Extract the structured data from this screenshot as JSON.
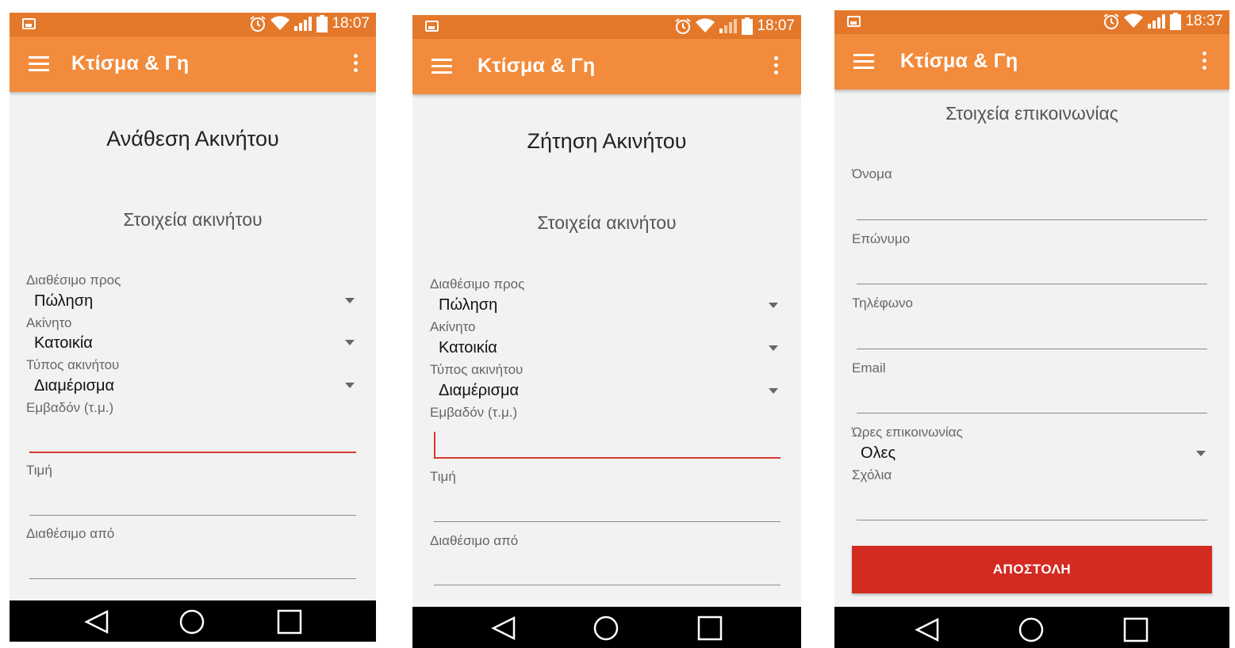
{
  "phones": [
    {
      "status": {
        "time": "18:07"
      },
      "appbar": {
        "title": "Κτίσμα & Γη"
      },
      "form": {
        "title": "Ανάθεση Ακινήτου",
        "section": "Στοιχεία ακινήτου",
        "available_for_label": "Διαθέσιμο προς",
        "available_for_value": "Πώληση",
        "property_label": "Ακίνητο",
        "property_value": "Κατοικία",
        "property_type_label": "Τύπος ακινήτου",
        "property_type_value": "Διαμέρισμα",
        "area_label": "Εμβαδόν (τ.μ.)",
        "price_label": "Τιμή",
        "available_from_label": "Διαθέσιμο από"
      }
    },
    {
      "status": {
        "time": "18:07"
      },
      "appbar": {
        "title": "Κτίσμα & Γη"
      },
      "form": {
        "title": "Ζήτηση Ακινήτου",
        "section": "Στοιχεία ακινήτου",
        "available_for_label": "Διαθέσιμο προς",
        "available_for_value": "Πώληση",
        "property_label": "Ακίνητο",
        "property_value": "Κατοικία",
        "property_type_label": "Τύπος ακινήτου",
        "property_type_value": "Διαμέρισμα",
        "area_label": "Εμβαδόν (τ.μ.)",
        "price_label": "Τιμή",
        "available_from_label": "Διαθέσιμο από"
      }
    },
    {
      "status": {
        "time": "18:37"
      },
      "appbar": {
        "title": "Κτίσμα & Γη"
      },
      "form": {
        "section": "Στοιχεία επικοινωνίας",
        "first_name_label": "Όνομα",
        "last_name_label": "Επώνυμο",
        "phone_label": "Τηλέφωνο",
        "email_label": "Email",
        "contact_hours_label": "Ώρες επικοινωνίας",
        "contact_hours_value": "Ολες",
        "comments_label": "Σχόλια",
        "send_label": "ΑΠΟΣΤΟΛΗ"
      }
    }
  ],
  "colors": {
    "statusbar": "#e4782a",
    "appbar": "#f28b3b",
    "accent_red": "#d32a22",
    "background": "#f2f2f2"
  },
  "icons": [
    "image-icon",
    "alarm-icon",
    "wifi-icon",
    "signal-icon",
    "battery-icon",
    "menu-icon",
    "more-vert-icon",
    "dropdown-arrow-icon",
    "back-icon",
    "home-icon",
    "recents-icon"
  ]
}
